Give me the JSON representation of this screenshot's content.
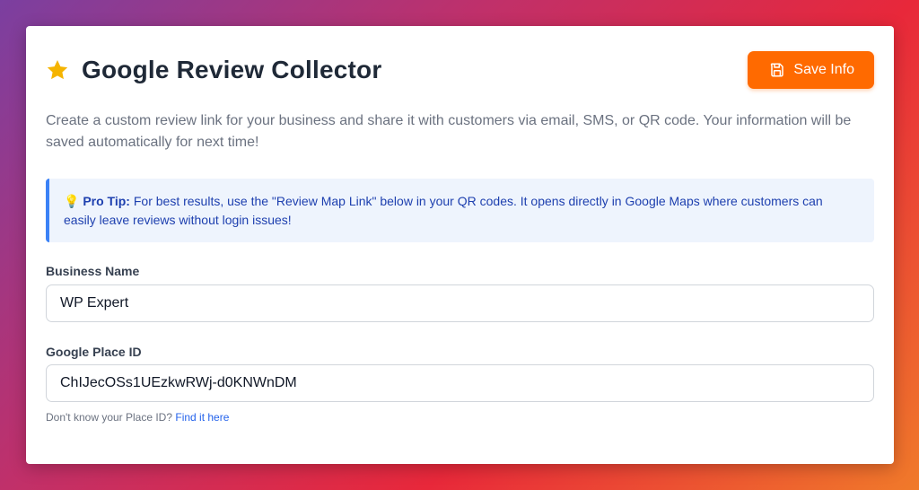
{
  "header": {
    "title": "Google Review Collector",
    "title_icon": "star-icon",
    "save_label": "Save Info",
    "save_icon": "floppy-disk-icon"
  },
  "description": "Create a custom review link for your business and share it with customers via email, SMS, or QR code. Your information will be saved automatically for next time!",
  "tip": {
    "icon": "💡",
    "label": "Pro Tip:",
    "text": " For best results, use the \"Review Map Link\" below in your QR codes. It opens directly in Google Maps where customers can easily leave reviews without login issues!"
  },
  "form": {
    "business_name": {
      "label": "Business Name",
      "value": "WP Expert"
    },
    "place_id": {
      "label": "Google Place ID",
      "value": "ChIJecOSs1UEzkwRWj-d0KNWnDM"
    },
    "hint_text": "Don't know your Place ID? ",
    "hint_link": "Find it here"
  },
  "colors": {
    "accent": "#ff6a00",
    "star": "#f5b400",
    "tip_border": "#3b82f6",
    "tip_text": "#1e40af",
    "link": "#2563eb"
  }
}
